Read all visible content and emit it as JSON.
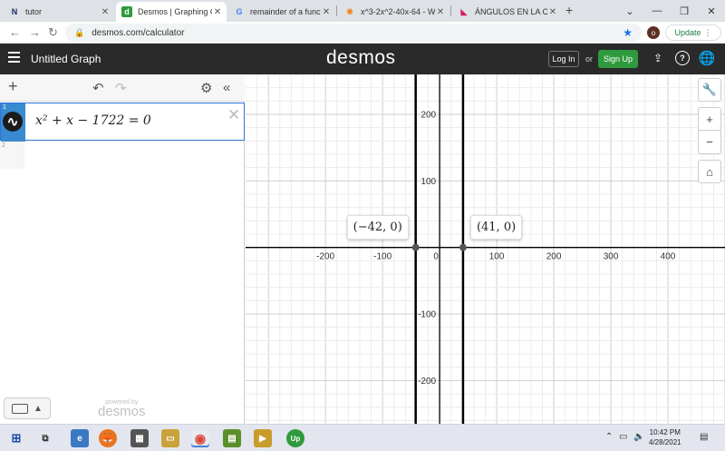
{
  "browser": {
    "tabs": [
      {
        "label": "tutor",
        "icon": "N",
        "icon_color": "#1a2a6c",
        "active": false
      },
      {
        "label": "Desmos | Graphing C",
        "icon": "d",
        "icon_color": "#2f9a3d",
        "active": true
      },
      {
        "label": "remainder of a functio",
        "icon": "G",
        "icon_color": "#4285f4",
        "active": false
      },
      {
        "label": "x^3-2x^2-40x-64 - W",
        "icon": "✹",
        "icon_color": "#f08a24",
        "active": false
      },
      {
        "label": "ÁNGULOS EN LA CIR",
        "icon": "◣",
        "icon_color": "#d81b60",
        "active": false
      }
    ],
    "url": "desmos.com/calculator",
    "profile_initial": "o",
    "update_label": "Update"
  },
  "desmos": {
    "graph_title": "Untitled Graph",
    "logo": "desmos",
    "login_label": "Log In",
    "or_label": "or",
    "signup_label": "Sign Up",
    "expressions": [
      {
        "index": "1",
        "latex_display": "x² + x − 1722 = 0",
        "color": "#000000"
      },
      {
        "index": "2",
        "latex_display": ""
      }
    ],
    "powered_by": "powered by",
    "powered_logo": "desmos"
  },
  "graph": {
    "x_range": [
      -340,
      500
    ],
    "y_range": [
      -265,
      260
    ],
    "x_ticks": [
      "-200",
      "-100",
      "0",
      "100",
      "200",
      "300",
      "400"
    ],
    "x_tick_values": [
      -200,
      -100,
      0,
      100,
      200,
      300,
      400
    ],
    "y_ticks": [
      "200",
      "100",
      "-100",
      "-200"
    ],
    "y_tick_values": [
      200,
      100,
      -100,
      -200
    ],
    "minor_step": 20,
    "roots": [
      -42,
      41
    ],
    "point_labels": [
      "(−42, 0)",
      "(41, 0)"
    ],
    "line_color": "#000000",
    "grid_minor_color": "#ececec",
    "grid_major_color": "#cfcfcf"
  },
  "taskbar": {
    "time": "10:42 PM",
    "date": "4/28/2021"
  }
}
